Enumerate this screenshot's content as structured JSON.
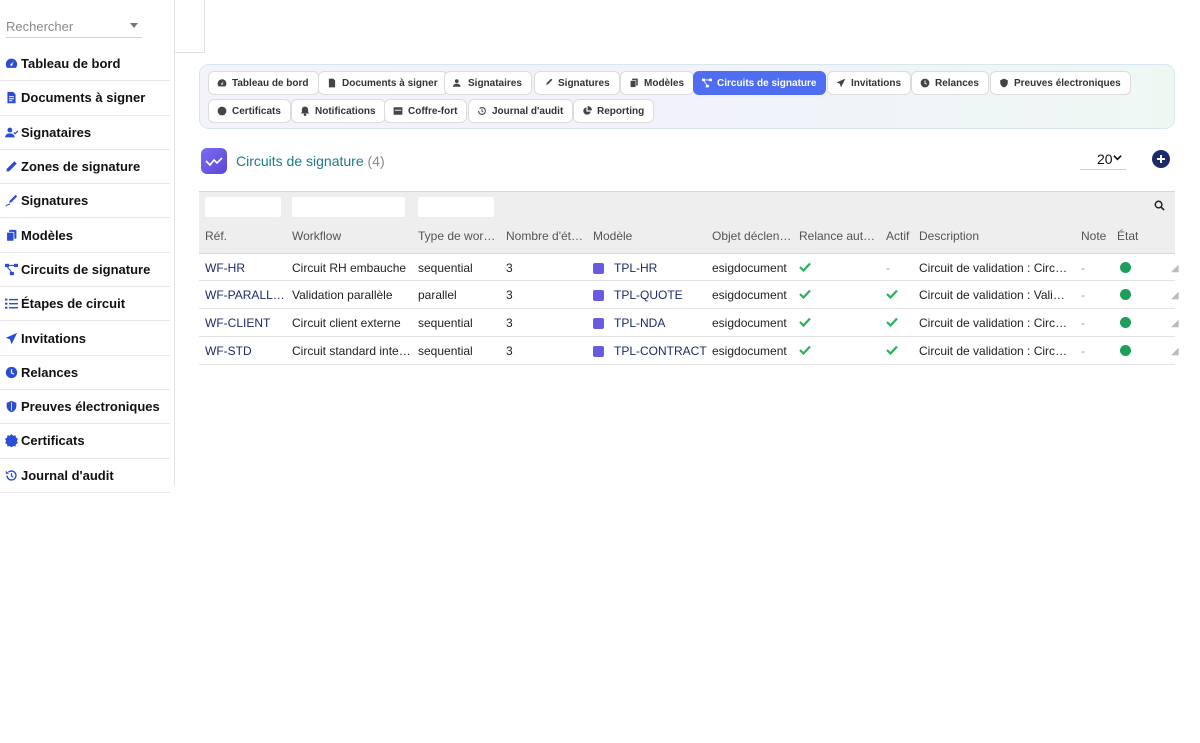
{
  "sidebar": {
    "search_placeholder": "Rechercher",
    "items": [
      {
        "label": "Tableau de bord",
        "icon": "dashboard-icon"
      },
      {
        "label": "Documents à signer",
        "icon": "document-icon"
      },
      {
        "label": "Signataires",
        "icon": "users-icon"
      },
      {
        "label": "Zones de signature",
        "icon": "pen-icon"
      },
      {
        "label": "Signatures",
        "icon": "signature-icon"
      },
      {
        "label": "Modèles",
        "icon": "copy-icon"
      },
      {
        "label": "Circuits de signature",
        "icon": "workflow-icon"
      },
      {
        "label": "Étapes de circuit",
        "icon": "list-icon"
      },
      {
        "label": "Invitations",
        "icon": "send-icon"
      },
      {
        "label": "Relances",
        "icon": "clock-icon"
      },
      {
        "label": "Preuves électroniques",
        "icon": "shield-icon"
      },
      {
        "label": "Certificats",
        "icon": "certificate-icon"
      },
      {
        "label": "Journal d'audit",
        "icon": "history-icon"
      }
    ]
  },
  "tabs": [
    {
      "label": "Tableau de bord",
      "icon": "dashboard-icon"
    },
    {
      "label": "Documents à signer",
      "icon": "document-icon"
    },
    {
      "label": "Signataires",
      "icon": "users-icon"
    },
    {
      "label": "Signatures",
      "icon": "signature-icon"
    },
    {
      "label": "Modèles",
      "icon": "copy-icon"
    },
    {
      "label": "Circuits de signature",
      "icon": "workflow-icon",
      "active": true
    },
    {
      "label": "Invitations",
      "icon": "send-icon"
    },
    {
      "label": "Relances",
      "icon": "clock-icon"
    },
    {
      "label": "Preuves électroniques",
      "icon": "shield-icon"
    },
    {
      "label": "Certificats",
      "icon": "certificate-icon"
    },
    {
      "label": "Notifications",
      "icon": "bell-icon"
    },
    {
      "label": "Coffre-fort",
      "icon": "vault-icon"
    },
    {
      "label": "Journal d'audit",
      "icon": "history-icon"
    },
    {
      "label": "Reporting",
      "icon": "chart-pie-icon"
    }
  ],
  "header": {
    "title": "Circuits de signature",
    "count": "(4)",
    "page_size": "20"
  },
  "table": {
    "columns": [
      "Réf.",
      "Workflow",
      "Type de wor…",
      "Nombre d'ét…",
      "Modèle",
      "Objet déclen…",
      "Relance aut…",
      "Actif",
      "Description",
      "Note",
      "État"
    ],
    "rows": [
      {
        "ref": "WF-HR",
        "workflow": "Circuit RH embauche",
        "type": "sequential",
        "steps": "3",
        "model": "TPL-HR",
        "object": "esigdocument",
        "relance": true,
        "actif": false,
        "description": "Circuit de validation : Circuit…",
        "note": "-",
        "etat": "active"
      },
      {
        "ref": "WF-PARALLEL",
        "workflow": "Validation parallèle",
        "type": "parallel",
        "steps": "3",
        "model": "TPL-QUOTE",
        "object": "esigdocument",
        "relance": true,
        "actif": true,
        "description": "Circuit de validation : Validat…",
        "note": "-",
        "etat": "active"
      },
      {
        "ref": "WF-CLIENT",
        "workflow": "Circuit client externe",
        "type": "sequential",
        "steps": "3",
        "model": "TPL-NDA",
        "object": "esigdocument",
        "relance": true,
        "actif": true,
        "description": "Circuit de validation : Circuit…",
        "note": "-",
        "etat": "active"
      },
      {
        "ref": "WF-STD",
        "workflow": "Circuit standard interne",
        "type": "sequential",
        "steps": "3",
        "model": "TPL-CONTRACT",
        "object": "esigdocument",
        "relance": true,
        "actif": true,
        "description": "Circuit de validation : Circuit…",
        "note": "-",
        "etat": "active"
      }
    ],
    "inactive_placeholder": "-",
    "colors": {
      "check": "#2bb05a",
      "status_dot": "#1f9d5a",
      "ref_link": "#1d2a6b"
    }
  },
  "colors": {
    "accent": "#4f6df0",
    "title": "#1b7a87",
    "add_button": "#1d2a6b"
  }
}
